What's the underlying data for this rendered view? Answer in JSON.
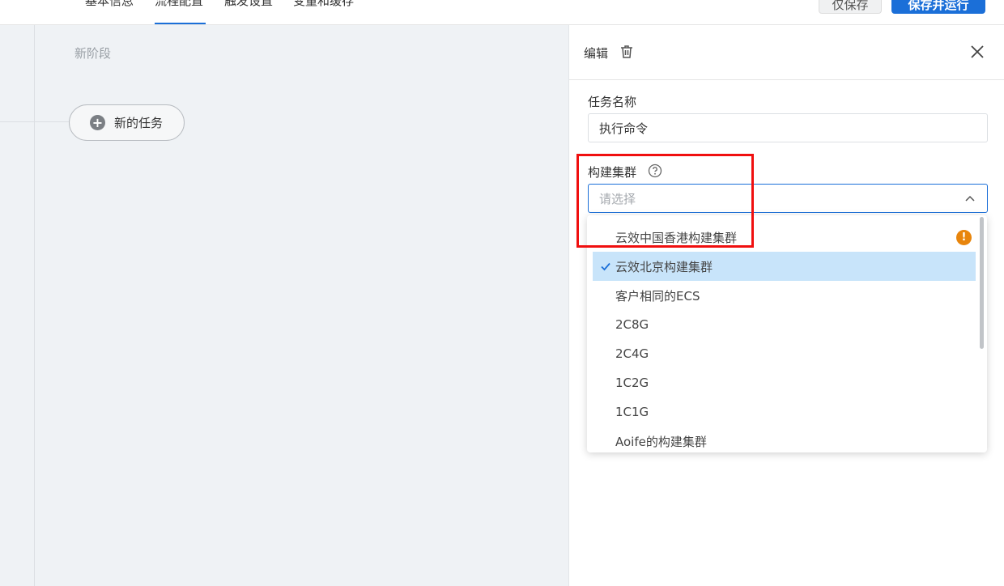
{
  "topbar": {
    "tabs": [
      "基本信息",
      "流程配置",
      "触发设置",
      "变量和缓存"
    ],
    "save_label": "仅保存",
    "run_label": "保存并运行"
  },
  "canvas": {
    "stage_name": "新阶段",
    "new_task_label": "新的任务"
  },
  "panel": {
    "title": "编辑",
    "task_name_label": "任务名称",
    "task_name_value": "执行命令",
    "cluster_label": "构建集群",
    "cluster_placeholder": "请选择"
  },
  "dropdown": {
    "options": [
      {
        "label": "云效中国香港构建集群",
        "warning": true
      },
      {
        "label": "云效北京构建集群",
        "selected": true
      },
      {
        "label": "客户相同的ECS"
      },
      {
        "label": "2C8G"
      },
      {
        "label": "2C4G"
      },
      {
        "label": "1C2G"
      },
      {
        "label": "1C1G"
      },
      {
        "label": "Aoife的构建集群"
      }
    ]
  },
  "colors": {
    "accent": "#1b6fd8",
    "selected_bg": "#c8e4fa",
    "warning": "#e8850c",
    "highlight": "#f00f0f"
  }
}
